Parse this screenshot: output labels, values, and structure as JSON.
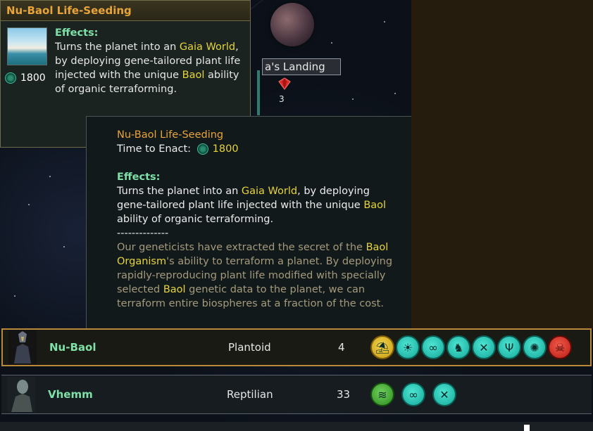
{
  "small_tooltip": {
    "title": "Nu-Baol Life-Seeding",
    "cost": "1800",
    "effects_label": "Effects:",
    "text_1": "Turns the planet into an ",
    "text_gaia": "Gaia World",
    "text_2": ", by deploying gene-tailored plant life injected with the unique ",
    "text_baol": "Baol",
    "text_3": " ability of organic terraforming."
  },
  "planet_label": {
    "name": "a's Landing",
    "count": "3"
  },
  "big_tooltip": {
    "title": "Nu-Baol Life-Seeding",
    "time_label": "Time to Enact: ",
    "time_value": "1800",
    "effects_label": "Effects:",
    "e1": "Turns the planet into an ",
    "e_gaia": "Gaia World",
    "e2": ", by deploying gene-tailored plant life injected with the unique ",
    "e_baol": "Baol",
    "e3": " ability of organic terraforming.",
    "separator": "--------------",
    "l1": "Our geneticists have extracted the secret of the ",
    "l_organism": "Baol Organism",
    "l2": "'s ability to terraform a planet. By deploying rapidly-reproducing plant life modified with specially selected ",
    "l_baol": "Baol",
    "l3": " genetic data to the planet, we can terraform entire biospheres at a fraction of the cost."
  },
  "species": [
    {
      "name": "Nu-Baol",
      "class": "Plantoid",
      "count": "4",
      "traits": [
        "island-icon",
        "sun-icon",
        "cells-icon",
        "elephant-icon",
        "tools-icon",
        "fork-icon",
        "gear-icon",
        "skull-icon"
      ]
    },
    {
      "name": "Vhemm",
      "class": "Reptilian",
      "count": "33",
      "traits": [
        "wave-icon",
        "cells-icon",
        "tools-icon"
      ]
    }
  ],
  "colors": {
    "accent_orange": "#e8a43a",
    "highlight_yellow": "#e6d43a",
    "effect_green": "#7fe0a8",
    "selected_border": "#b8893a"
  }
}
